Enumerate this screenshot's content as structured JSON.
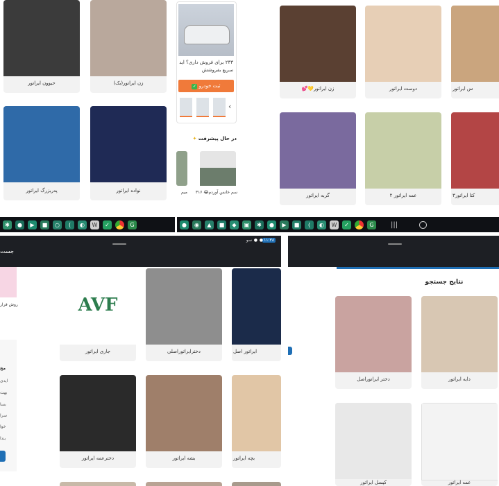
{
  "top_left": {
    "cards": [
      {
        "label": "حیوون ایراتور",
        "color": "#3b3b3b"
      },
      {
        "label": "زن ایراتور(بک)",
        "color": "#b9a89c"
      },
      {
        "label": "پدربزرگ ایراتور",
        "color": "#2f6aa8"
      },
      {
        "label": "نواده ایراتور",
        "color": "#1f2a55"
      }
    ],
    "ad": {
      "text": "۲۳۳ برای فروش داری؟ اید سریع بفروشش",
      "button": "ثبت خودرو",
      "arrow": "‹"
    },
    "progress": {
      "title": "در حال پیشرفت",
      "item1_label": "سم خانس آوردم😂 ۳۱۶",
      "item2_label": "میم"
    }
  },
  "top_right": {
    "cards": [
      {
        "label": "زن ایراتور💛💕",
        "color": "#5a4032"
      },
      {
        "label": "دوست ایراتور",
        "color": "#e7cfb6"
      },
      {
        "label": "س ایراتور",
        "color": "#caa57e"
      },
      {
        "label": "گربه ایراتور",
        "color": "#7a6a9e"
      },
      {
        "label": "عمه ایراتور ۲",
        "color": "#c7cfa8"
      },
      {
        "label": "کتا ایراتور۳",
        "color": "#b34545"
      }
    ]
  },
  "bottom_left": {
    "status_time": "۱۱:۳۸",
    "status_extra": "سو",
    "header_partial": "جست",
    "side_profile": "روش فرار",
    "side_lines": [
      "مخ",
      "ایدی",
      "بهت",
      "بسا",
      "سرا",
      "خوا",
      "بندا"
    ],
    "cards": [
      {
        "label": "جاری ایراتور",
        "logo": "AVF",
        "color": "#ffffff"
      },
      {
        "label": "دخترایراتوراصلی",
        "color": "#8e8e8e"
      },
      {
        "label": "ایراتور اصل",
        "color": "#1b2b4a"
      },
      {
        "label": "دخترعمه ایراتور",
        "color": "#2a2a2a"
      },
      {
        "label": "بشه ایراتور",
        "color": "#9f7f6a"
      },
      {
        "label": "بچه ایراتور",
        "color": "#e1c6a6"
      }
    ]
  },
  "bottom_right": {
    "title": "نتایج جستجو",
    "cards": [
      {
        "label": "دختر ایراتوراصل",
        "color": "#c9a3a0"
      },
      {
        "label": "دایه ایراتور",
        "color": "#d8c7b3"
      },
      {
        "label": "کپسل ایراتور",
        "color": "#e8e8e8"
      },
      {
        "label": "عمه ایراتور",
        "color": "#f3f3f3"
      }
    ]
  },
  "taskbar_icons": [
    "app-a",
    "app-b",
    "app-c",
    "app-d",
    "app-e",
    "app-f",
    "app-g",
    "app-h",
    "app-i",
    "app-j",
    "app-k"
  ]
}
